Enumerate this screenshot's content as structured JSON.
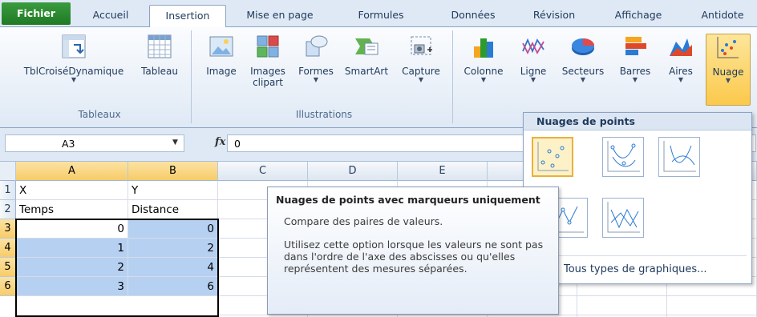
{
  "tabs": [
    "Fichier",
    "Accueil",
    "Insertion",
    "Mise en page",
    "Formules",
    "Données",
    "Révision",
    "Affichage",
    "Antidote"
  ],
  "ribbon": {
    "groups": {
      "tables": {
        "label": "Tableaux",
        "buttons": [
          {
            "label": "TblCroiséDynamique",
            "icon": "pivot-table-icon"
          },
          {
            "label": "Tableau",
            "icon": "table-icon"
          }
        ]
      },
      "illustrations": {
        "label": "Illustrations",
        "buttons": [
          {
            "label": "Image",
            "icon": "picture-icon"
          },
          {
            "label": "Images clipart",
            "icon": "clipart-icon"
          },
          {
            "label": "Formes",
            "icon": "shapes-icon"
          },
          {
            "label": "SmartArt",
            "icon": "smartart-icon"
          },
          {
            "label": "Capture",
            "icon": "screenshot-icon"
          }
        ]
      },
      "charts": {
        "buttons": [
          {
            "label": "Colonne",
            "icon": "column-chart-icon"
          },
          {
            "label": "Ligne",
            "icon": "line-chart-icon"
          },
          {
            "label": "Secteurs",
            "icon": "pie-chart-icon"
          },
          {
            "label": "Barres",
            "icon": "bar-chart-icon"
          },
          {
            "label": "Aires",
            "icon": "area-chart-icon"
          },
          {
            "label": "Nuage",
            "icon": "scatter-chart-icon"
          }
        ]
      }
    }
  },
  "formula_bar": {
    "name_box": "A3",
    "fx": "fx",
    "value": "0"
  },
  "grid": {
    "columns": [
      "A",
      "B",
      "C",
      "D",
      "E"
    ],
    "rows": [
      {
        "n": "1",
        "a": "X",
        "b": "Y"
      },
      {
        "n": "2",
        "a": "Temps",
        "b": "Distance"
      },
      {
        "n": "3",
        "a": "0",
        "b": "0"
      },
      {
        "n": "4",
        "a": "1",
        "b": "2"
      },
      {
        "n": "5",
        "a": "2",
        "b": "4"
      },
      {
        "n": "6",
        "a": "3",
        "b": "6"
      }
    ]
  },
  "dropdown": {
    "header": "Nuages de points",
    "options": [
      "scatter-markers-only-icon",
      "scatter-smooth-lines-markers-icon",
      "scatter-smooth-lines-icon",
      "scatter-straight-lines-markers-icon",
      "scatter-straight-lines-icon"
    ],
    "all_types": "Tous types de graphiques..."
  },
  "tooltip": {
    "title": "Nuages de points avec marqueurs uniquement",
    "line1": "Compare des paires de valeurs.",
    "body": "Utilisez cette option lorsque les valeurs ne sont pas dans l'ordre de l'axe des abscisses ou qu'elles représentent des mesures séparées."
  },
  "colors": {
    "file_tab": "#2a8a2e",
    "selection": "#b6d0f1",
    "active_header": "#f8cc68"
  }
}
